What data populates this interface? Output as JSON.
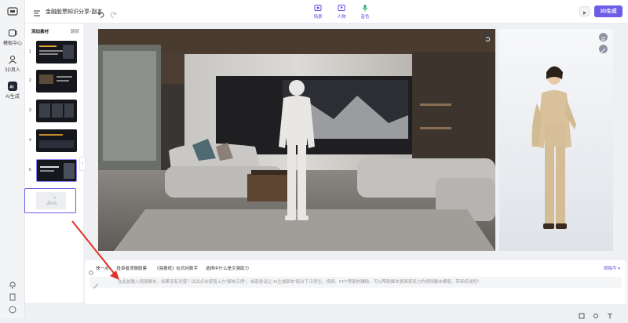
{
  "sidebar": {
    "items": [
      {
        "label": "模板中心"
      },
      {
        "label": "3D真人"
      },
      {
        "label": "AI生成",
        "active": true
      }
    ]
  },
  "header": {
    "title": "金融股票知识分享-副本",
    "tabs": [
      {
        "label": "场景",
        "icon": "scene-icon"
      },
      {
        "label": "人物",
        "icon": "person-icon"
      },
      {
        "label": "音色",
        "icon": "mic-icon"
      }
    ],
    "generate_label": "3D生成"
  },
  "materials": {
    "title": "添加素材",
    "action": "跳转",
    "slides": [
      "1",
      "2",
      "3",
      "4",
      "5",
      "6"
    ]
  },
  "script": {
    "chips": [
      "快一点",
      "投资者须做股票",
      "《海报纸》在讯问数字",
      "选择中什么是文强助力"
    ],
    "voice_label": "朝稿写",
    "placeholder": "在此处输入视频脚本，如果没有灵感？试试点击按钮上方“脚本示例”，或者尝试让“AI生成脚本”配合下示例生。视频、PPT等素材辅助，可以帮助脚本更具表现力的视频脚本模版，带来好试吧！"
  },
  "colors": {
    "accent": "#6c5ce7",
    "annotation": "#e0312b"
  }
}
